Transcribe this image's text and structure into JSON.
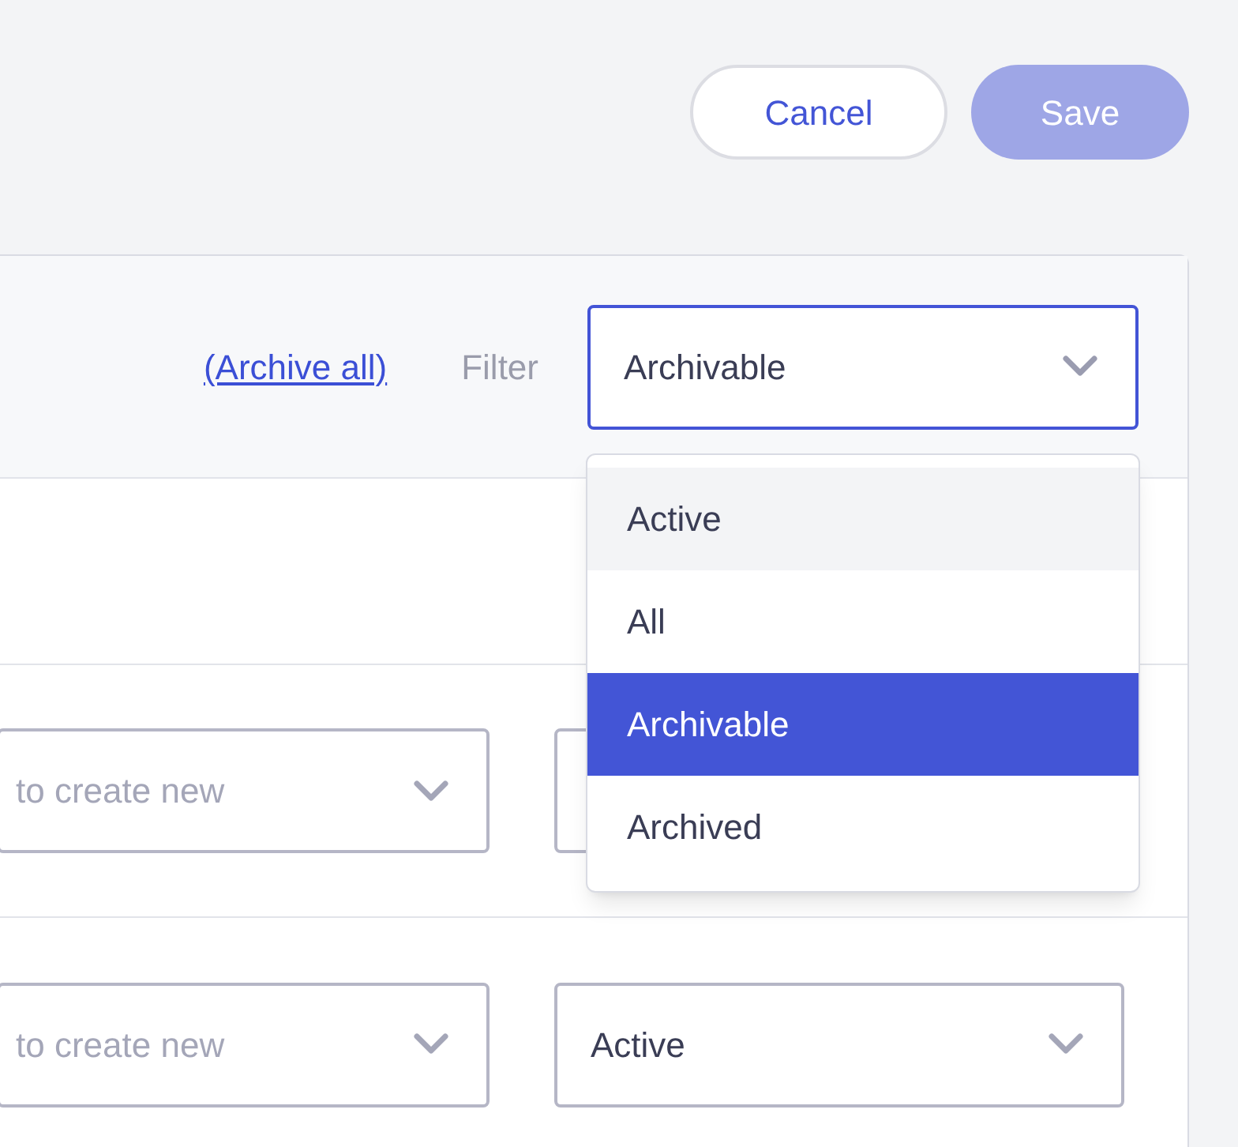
{
  "actions": [
    {
      "label": "Cancel",
      "kind": "secondary",
      "disabled": false
    },
    {
      "label": "Save",
      "kind": "primary",
      "disabled": true
    }
  ],
  "toolbar": {
    "link": "(Archive all)",
    "filter_label": "Filter",
    "filter_value": "Archivable",
    "filter_focused": true
  },
  "filter_menu": {
    "options": [
      {
        "label": "Active",
        "selected": false,
        "highlighted": true
      },
      {
        "label": "All",
        "selected": false,
        "highlighted": false
      },
      {
        "label": "Archivable",
        "selected": true,
        "highlighted": false
      },
      {
        "label": "Archived",
        "selected": false,
        "highlighted": false
      }
    ]
  },
  "rows": [
    {
      "column_1": {
        "placeholder": "to create new"
      }
    },
    {
      "column_1": {
        "placeholder": "to create new"
      },
      "column_2": {
        "value": "Active"
      }
    }
  ]
}
